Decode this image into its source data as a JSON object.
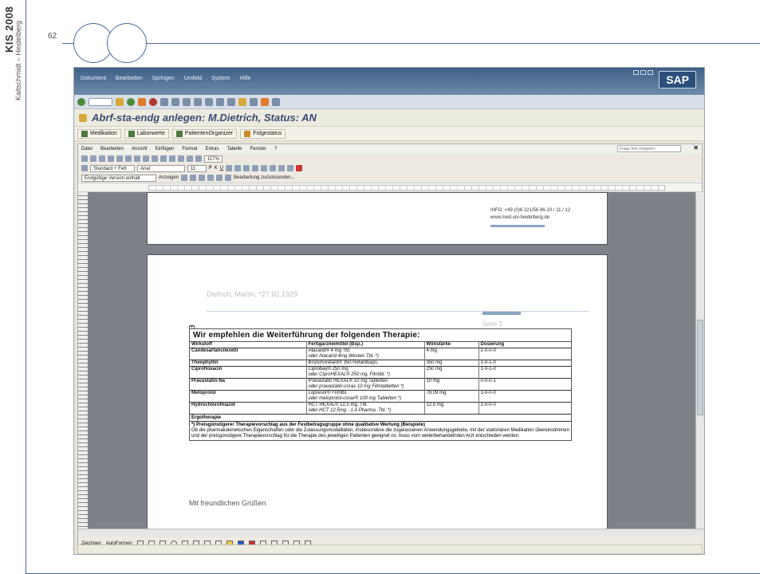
{
  "slide": {
    "sidebar_title": "KIS 2008",
    "sidebar_author": "Kaltschmidt – Heidelberg",
    "page_number": "62"
  },
  "sap": {
    "menu": [
      "Dokument",
      "Bearbeiten",
      "Springen",
      "Umfeld",
      "System",
      "Hilfe"
    ],
    "logo": "SAP",
    "title": "Abrf-sta-endg anlegen: M.Dietrich, Status: AN",
    "tabs": [
      "Medikation",
      "Laborwerte",
      "PatientenOrganizer",
      "Folgestatus"
    ]
  },
  "word": {
    "menu": [
      "Datei",
      "Bearbeiten",
      "Ansicht",
      "Einfügen",
      "Format",
      "Extras",
      "Tabelle",
      "Fenster",
      "?"
    ],
    "help_placeholder": "Frage hier eingeben",
    "style": "Standard + Fett",
    "font": "Arial",
    "font_size": "11",
    "zoom": "117%",
    "markup_view": "Endgültige Version enthält Markups",
    "show_label": "Anzeigen",
    "edit_label": "Bearbeitung zurücksenden...",
    "draw_label": "Zeichnen",
    "autoshapes_label": "AutoFormen"
  },
  "document": {
    "info_line1": "INFO: +49 (0)6 221/56 86-10 / 11 / 12",
    "info_line2": "www.med.uni-heidelberg.de",
    "patient_line": "Dietrich, Martin, *27.02.1929",
    "page_label": "Seite 2",
    "table_heading": "Wir empfehlen die Weiterführung der folgenden Therapie:",
    "columns": [
      "Wirkstoff",
      "Fertigarzneimittel (Bsp.)",
      "Wirkstärke",
      "Dosierung"
    ],
    "rows": [
      {
        "wirkstoff": "Candesartancilexetil",
        "lines": [
          [
            "Atacand® 4 mg Tbl.",
            "4 mg",
            "2-0-0-0"
          ],
          [
            "oder Atacand 4mg Westen Tbl. *)",
            "",
            ""
          ]
        ]
      },
      {
        "wirkstoff": "Theophyllin",
        "lines": [
          [
            "Bronchoretard® 350 Retardkaps.",
            "350 mg",
            "1-0-1-0"
          ]
        ]
      },
      {
        "wirkstoff": "Ciprofloxacin",
        "lines": [
          [
            "Ciprobay® 250 mg",
            "250 mg",
            "1-0-1-0"
          ],
          [
            "oder CiproHEXAL® 250 mg, Filmtbl. *)",
            "",
            ""
          ]
        ]
      },
      {
        "wirkstoff": "Pravastatin-Na",
        "lines": [
          [
            "Pravastatin HEXAL® 10 mg Tabletten",
            "10 mg",
            "0-0-0-1"
          ],
          [
            "oder pravastatin-corax 10 mg Filmtabletten *)",
            "",
            ""
          ]
        ]
      },
      {
        "wirkstoff": "Metoprolol",
        "lines": [
          [
            "Lopresor® Filmtbl.",
            "78,09 mg",
            "1-0-0-0"
          ],
          [
            "oder metoprolol-corax® 100 mg Tabletten *)",
            "",
            ""
          ]
        ]
      },
      {
        "wirkstoff": "Hydrochlorothiazid",
        "lines": [
          [
            "HCT HEXAL® 12,5 mg, Tbl.",
            "12,5 mg",
            "1-0-0-0"
          ],
          [
            "oder HCT 12,5mg - 1 A Pharma, Tbl. *)",
            "",
            ""
          ]
        ]
      }
    ],
    "ergo_label": "Ergotherapie",
    "footnote_bold": "*) Preisgünstigerer Therapievorschlag aus der Festbetragsgruppe ohne qualitative Wertung (Beispiele)",
    "footnote_text": "Ob die pharmakokinetischen Eigenschaften oder die Zulassungsmodalitäten, insbesondere die zugelassenen Anwendungsgebiete, mit der stationären Medikation übereinstimmen und der preisgünstigere Therapievorschlag für die Therapie des jeweiligen Patienten geeignet ist, muss vom weiterbehandelnden Arzt entschieden werden.",
    "closing": "Mit freundlichen Grüßen"
  }
}
